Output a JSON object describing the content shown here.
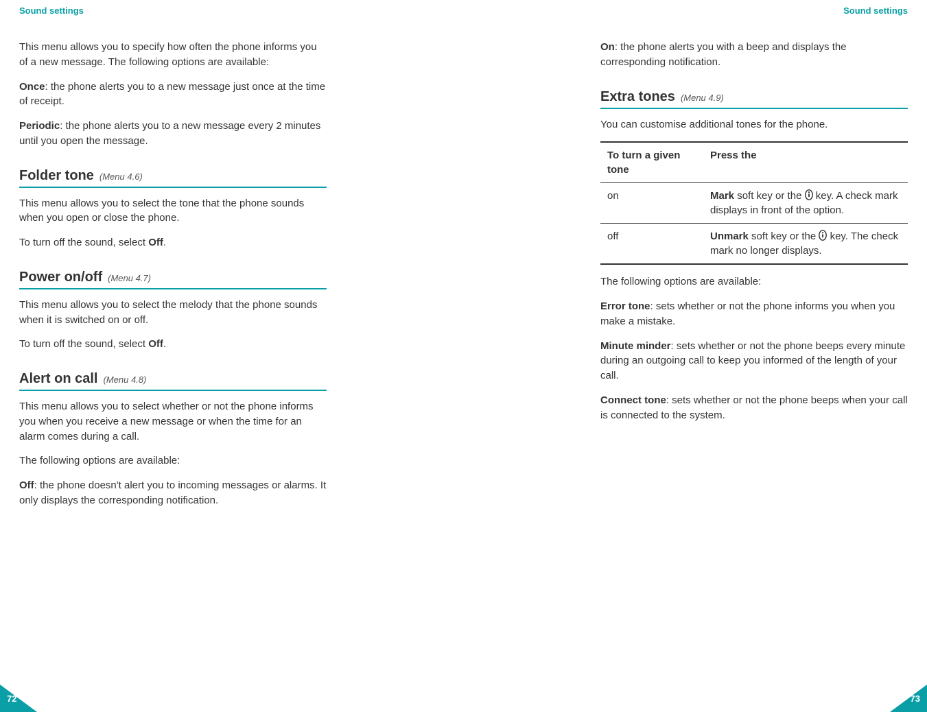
{
  "left": {
    "running_head": "Sound settings",
    "page_number": "72",
    "intro": "This menu allows you to specify how often the phone informs you of a new message. The following options are available:",
    "once_label": "Once",
    "once_text": ": the phone alerts you to a new message just once at the time of receipt.",
    "periodic_label": "Periodic",
    "periodic_text": ": the phone alerts you to a new message every 2 minutes until you open the message.",
    "sections": {
      "folder_tone": {
        "title": "Folder tone",
        "menu": "(Menu 4.6)",
        "p1": "This menu allows you to select the tone that the phone sounds when you open or close the phone.",
        "p2a": "To turn off the sound, select ",
        "p2b": "Off",
        "p2c": "."
      },
      "power": {
        "title": "Power on/off",
        "menu": "(Menu 4.7)",
        "p1": "This menu allows you to select the melody that the phone sounds when it is switched on or off.",
        "p2a": "To turn off the sound, select ",
        "p2b": "Off",
        "p2c": "."
      },
      "alert": {
        "title": "Alert on call",
        "menu": "(Menu 4.8)",
        "p1": "This menu allows you to select whether or not the phone informs you when you receive a new message or when the time for an alarm comes during a call.",
        "p2": "The following options are available:",
        "off_label": "Off",
        "off_text": ": the phone doesn't alert you to incoming messages or alarms. It only displays the corresponding notification."
      }
    }
  },
  "right": {
    "running_head": "Sound settings",
    "page_number": "73",
    "on_label": "On",
    "on_text": ": the phone alerts you with a beep and displays the corresponding notification.",
    "extra": {
      "title": "Extra tones",
      "menu": "(Menu 4.9)",
      "intro": "You can customise additional tones for the phone.",
      "table": {
        "head1": "To turn a given tone",
        "head2": "Press the",
        "row1_col1": "on",
        "row1_mark": "Mark",
        "row1_rest_a": " soft key or the ",
        "row1_rest_b": " key. A check mark displays in front of the option.",
        "row2_col1": "off",
        "row2_unmark": "Unmark",
        "row2_rest_a": " soft key or the ",
        "row2_rest_b": " key. The check mark no longer displays."
      },
      "followup": "The following options are available:",
      "error_label": "Error tone",
      "error_text": ": sets whether or not the phone informs you when you make a mistake.",
      "minute_label": "Minute minder",
      "minute_text": ": sets whether or not the phone beeps every minute during an outgoing call to keep you informed of the length of your call.",
      "connect_label": "Connect tone",
      "connect_text": ": sets whether or not the phone beeps when your call is connected to the system."
    }
  }
}
